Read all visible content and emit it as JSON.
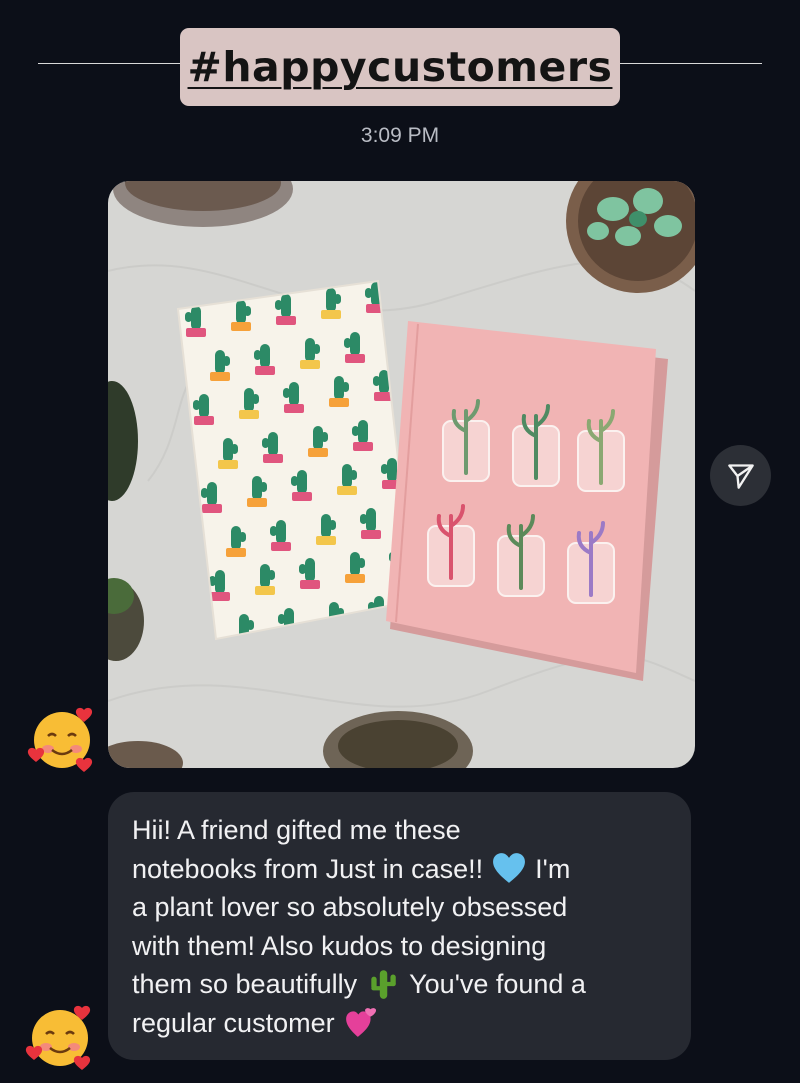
{
  "sticker": {
    "text": "#happycustomers"
  },
  "timestamp": "3:09 PM",
  "photo": {
    "colors": {
      "table": "#dcdcd8",
      "pink_notebook": "#f1b4b4",
      "cactus_notebook": "#f7f3ea",
      "cactus": "#2c8a66",
      "pot": "#e0557e"
    }
  },
  "share_icon": "paper-plane-icon",
  "reaction_icon": "smiling-face-with-hearts-icon",
  "message": {
    "line1": "Hii! A friend gifted me these",
    "line2_a": "notebooks from Just in case!!",
    "line2_emoji": "blue-heart-icon",
    "line2_b": "I'm",
    "line3": "a plant lover so absolutely obsessed",
    "line4": "with them! Also kudos to designing",
    "line5_a": "them so beautifully",
    "line5_emoji": "cactus-icon",
    "line5_b": "You've found a",
    "line6_a": "regular customer",
    "line6_emoji": "heart-with-ribbon-icon"
  }
}
